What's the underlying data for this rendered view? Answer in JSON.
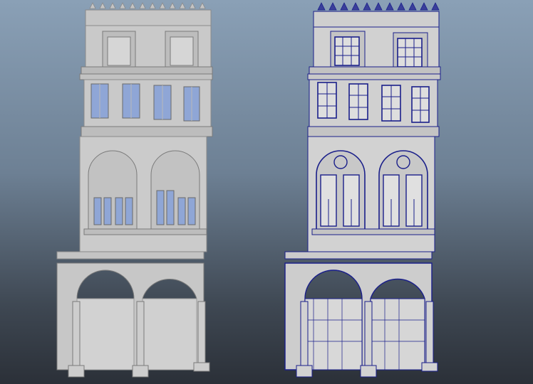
{
  "viewport": {
    "name": "3d-modeling-viewport",
    "background_top": "#8aa0b6",
    "background_bottom": "#2b3038"
  },
  "models": [
    {
      "name": "facade-model-shaded",
      "display_mode": "shaded",
      "surface_color": "#c9c9c9",
      "edge_color": "#7a7a7a",
      "glass_color": "#8fa6d6"
    },
    {
      "name": "facade-model-wireframe-on-shaded",
      "display_mode": "wireframe-on-shaded",
      "surface_color": "#cfcfcf",
      "edge_color": "#1a1f8a",
      "glass_color": "#d9d9d9"
    }
  ]
}
